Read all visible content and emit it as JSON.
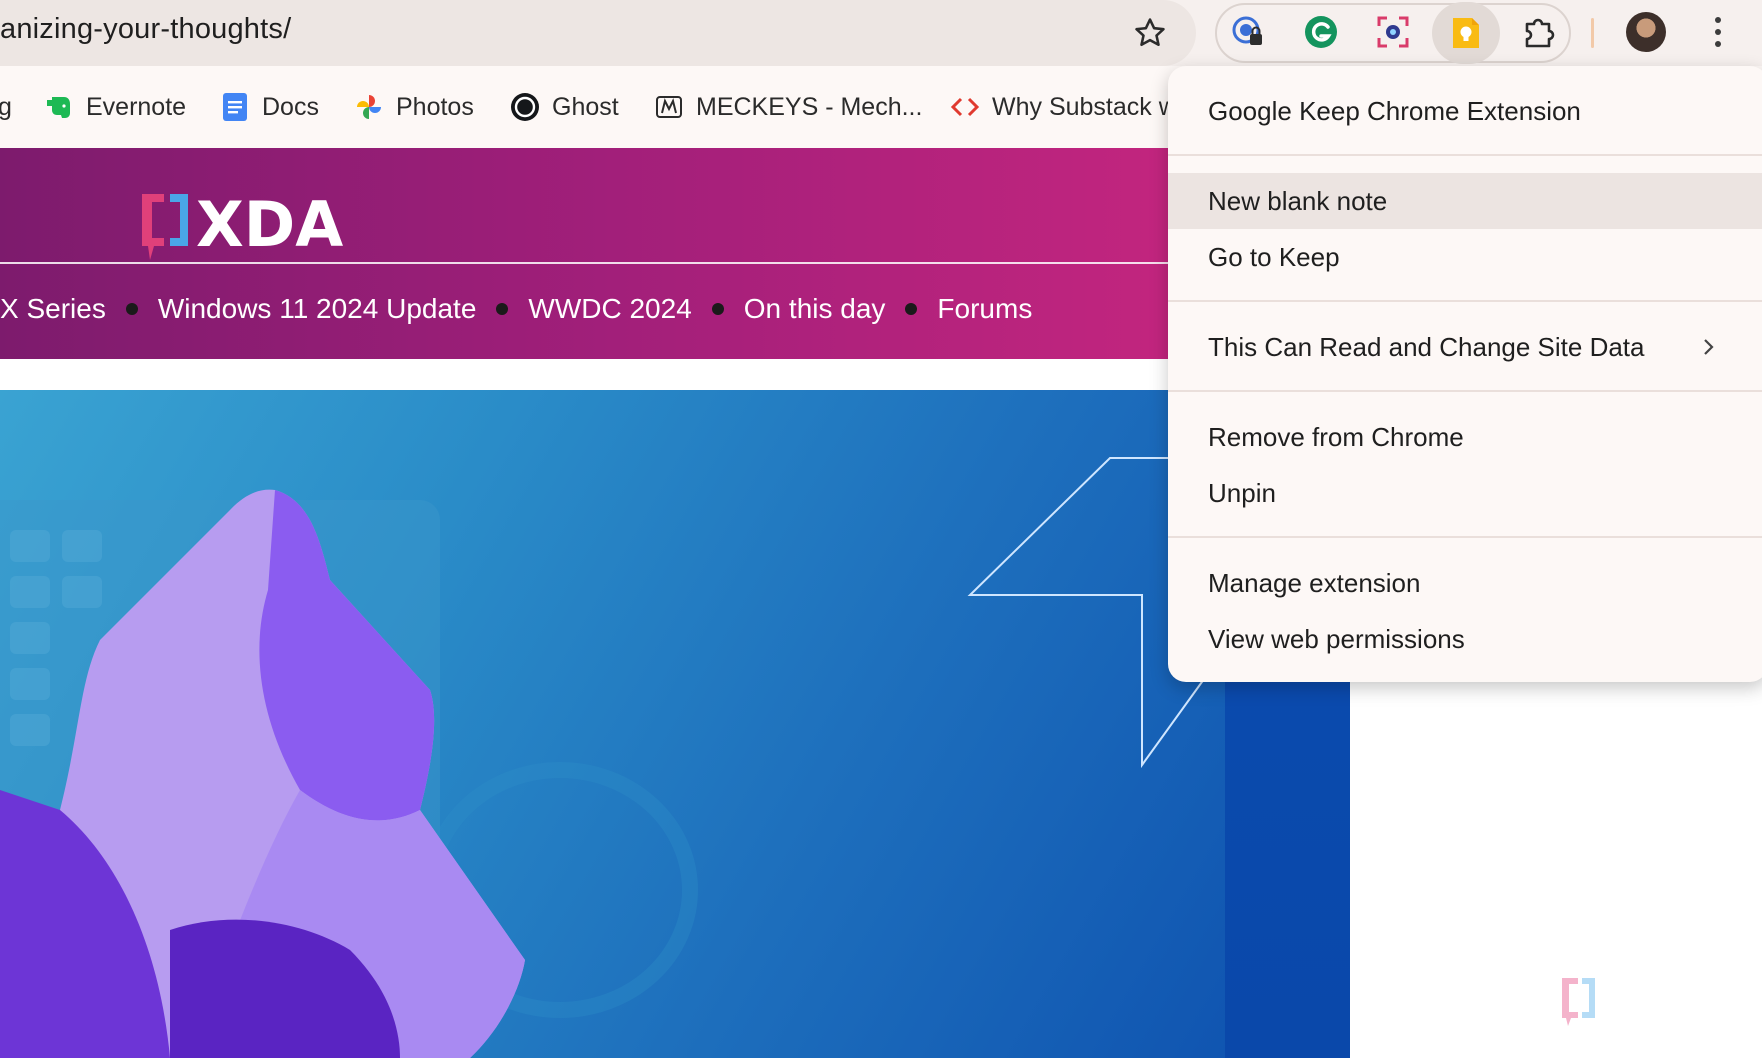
{
  "browser": {
    "url": "anizing-your-thoughts/",
    "extensions": [
      "password-manager-icon",
      "grammarly-icon",
      "screenshot-icon",
      "google-keep-icon",
      "extensions-puzzle-icon"
    ]
  },
  "bookmarks": [
    {
      "label": "g"
    },
    {
      "label": "Evernote"
    },
    {
      "label": "Docs"
    },
    {
      "label": "Photos"
    },
    {
      "label": "Ghost"
    },
    {
      "label": "MECKEYS - Mech..."
    },
    {
      "label": "Why Substack w"
    }
  ],
  "site": {
    "logo": "XDA",
    "nav": [
      "X Series",
      "Windows 11 2024 Update",
      "WWDC 2024",
      "On this day",
      "Forums"
    ]
  },
  "menu": {
    "title": "Google Keep Chrome Extension",
    "items": {
      "new_note": "New blank note",
      "go_keep": "Go to Keep",
      "site_data": "This Can Read and Change Site Data",
      "remove": "Remove from Chrome",
      "unpin": "Unpin",
      "manage": "Manage extension",
      "permissions": "View web permissions"
    }
  },
  "colors": {
    "keep_yellow": "#f9bb13",
    "xda_magenta": "#c6267f",
    "hero_blue": "#1e70bd"
  }
}
